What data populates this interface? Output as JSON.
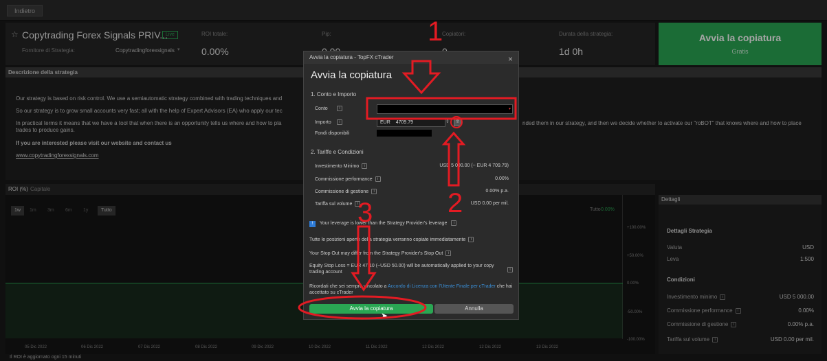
{
  "topbar": {
    "back": "Indietro"
  },
  "header": {
    "strategy_name": "Copytrading Forex Signals PRIV...",
    "live_badge": "Live",
    "provider_label": "Fornitore di Strategia:",
    "provider_name": "Copytradingforexsignals",
    "roi_label": "ROI totale:",
    "roi_value": "0.00%",
    "pip_label": "Pip:",
    "pip_value": "0.00",
    "copiers_label": "Copiatori:",
    "copiers_value": "0",
    "duration_label": "Durata della strategia:",
    "duration_value": "1d 0h",
    "start_label": "Avvia la copiatura",
    "start_sub": "Gratis"
  },
  "description": {
    "title": "Descrizione della strategia",
    "p1": "Our strategy is based on risk control. We use a semiautomatic strategy combined with trading techniques and",
    "p2": "So our strategy is to grow small accounts very fast; all with the help of Expert Advisors (EA) who apply our tec",
    "p3a": "In practical terms it means that we have a tool that when there is an opportunity tells us where and how to pla",
    "p3b": "trades to produce gains.",
    "p3c": "nded them in our strategy, and then we decide whether to activate our \"roBOT\" that knows where and how to place",
    "p4": "If you are interested please visit our website and contact us",
    "link": "www.copytradingforexsignals.com"
  },
  "chart": {
    "tabs": [
      "ROI (%)",
      "Capitale"
    ],
    "periods": [
      "1w",
      "1m",
      "3m",
      "6m",
      "1y",
      "Tutto"
    ],
    "legend_label": "Tutto",
    "legend_value": "0.00%",
    "y_ticks": [
      "+100.00%",
      "+50.00%",
      "0.00%",
      "-50.00%",
      "-100.00%"
    ],
    "x_ticks": [
      "05 Dic 2022",
      "06 Dic 2022",
      "07 Dic 2022",
      "08 Dic 2022",
      "09 Dic 2022",
      "10 Dic 2022",
      "11 Dic 2022",
      "12 Dic 2022",
      "12 Dic 2022",
      "13 Dic 2022"
    ],
    "footnote": "Il ROI è aggiornato ogni 15 minuti"
  },
  "details": {
    "title": "Dettagli",
    "section1": "Dettagli Strategia",
    "valuta_label": "Valuta",
    "valuta": "USD",
    "leva_label": "Leva",
    "leva": "1:500",
    "section2": "Condizioni",
    "min_label": "Investimento minimo",
    "min": "USD 5 000.00",
    "perf_label": "Commissione performance",
    "perf": "0.00%",
    "mgmt_label": "Commissione di gestione",
    "mgmt": "0.00% p.a.",
    "vol_label": "Tariffa sul volume",
    "vol": "USD 0.00 per mil."
  },
  "modal": {
    "window_title": "Avvia la copiatura - TopFX cTrader",
    "heading": "Avvia la copiatura",
    "sec1": "1. Conto e Importo",
    "conto_label": "Conto",
    "importo_label": "Importo",
    "currency": "EUR",
    "amount": "4709.79",
    "fondi_label": "Fondi disponibili",
    "sec2": "2. Tariffe e Condizioni",
    "min_label": "Investimento Minimo",
    "min": "USD 5 000.00 (~ EUR 4 709.79)",
    "perf_label": "Commissione performance",
    "perf": "0.00%",
    "mgmt_label": "Commissione di gestione",
    "mgmt": "0.00% p.a.",
    "vol_label": "Tariffa sul volume",
    "vol": "USD 0.00 per mil.",
    "warn_leverage": "Your leverage is lower than the Strategy Provider's leverage",
    "warn_positions": "Tutte le posizioni aperte della strategia verranno copiate immediatamente",
    "warn_stopout": "Your Stop Out may differ from the Strategy Provider's Stop Out",
    "warn_equity": "Equity Stop Loss = EUR 47.10 (~USD 50.00) will be automatically applied to your copy trading account",
    "license_text": "Ricordati che sei sempre vincolato a",
    "license_link": "Accordo di Licenza con l'Utente Finale per cTrader",
    "license_tail": "che hai accettato su cTrader",
    "confirm": "Avvia la copiatura",
    "cancel": "Annulla"
  },
  "annotations": {
    "n1": "1",
    "n2": "2",
    "n3": "3"
  },
  "colors": {
    "accent_green": "#2aa653",
    "annotation_red": "#e31b23",
    "link_blue": "#3a8fd8"
  }
}
